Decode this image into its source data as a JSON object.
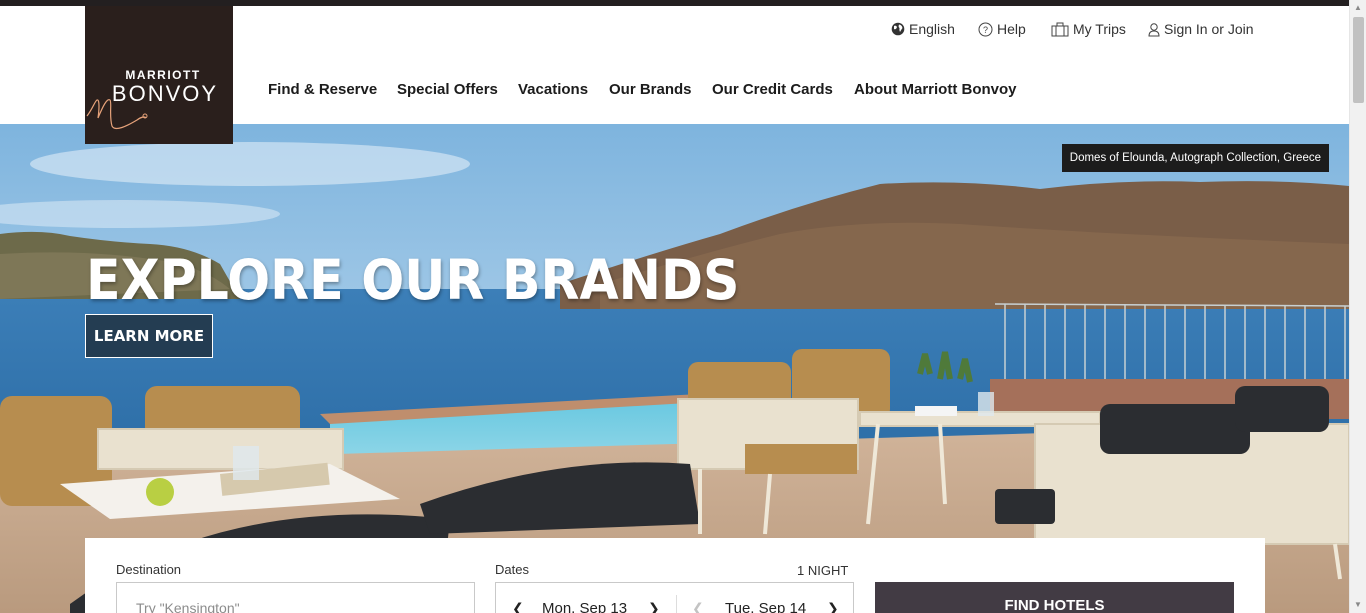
{
  "header": {
    "logo": {
      "line1": "MARRIOTT",
      "line2": "BONVOY"
    },
    "utility": [
      {
        "label": "English",
        "icon": "globe-icon"
      },
      {
        "label": "Help",
        "icon": "help-circle-icon"
      },
      {
        "label": "My Trips",
        "icon": "suitcase-icon"
      },
      {
        "label": "Sign In or Join",
        "icon": "user-icon"
      }
    ],
    "nav": [
      {
        "label": "Find & Reserve"
      },
      {
        "label": "Special Offers"
      },
      {
        "label": "Vacations"
      },
      {
        "label": "Our Brands"
      },
      {
        "label": "Our Credit Cards"
      },
      {
        "label": "About Marriott Bonvoy"
      }
    ]
  },
  "hero": {
    "caption": "Domes of Elounda, Autograph Collection, Greece",
    "headline": "EXPLORE OUR BRANDS",
    "cta": "LEARN MORE"
  },
  "search": {
    "destination_label": "Destination",
    "destination_placeholder": "Try \"Kensington\"",
    "dates_label": "Dates",
    "nights": "1 NIGHT",
    "checkin": "Mon, Sep 13",
    "checkout": "Tue, Sep 14",
    "submit": "FIND HOTELS"
  },
  "colors": {
    "logo_bg": "#2a1f1c",
    "accent": "#e6a27a",
    "topbar": "#231f20",
    "find_button": "#423b44"
  }
}
